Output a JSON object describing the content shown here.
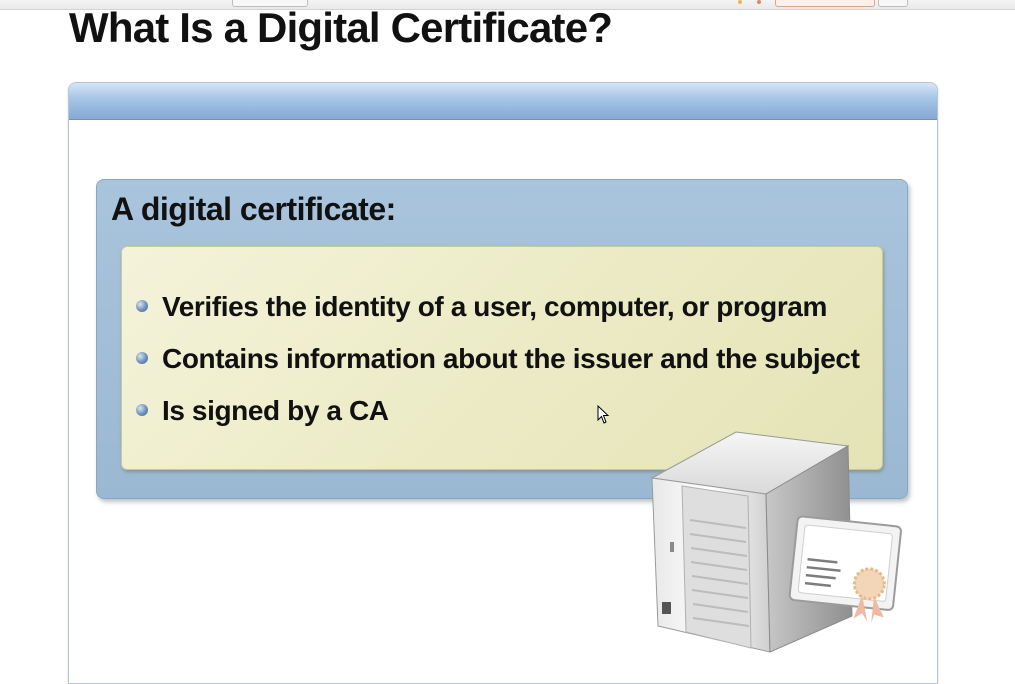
{
  "slide": {
    "title": "What Is a Digital Certificate?",
    "box_heading": "A digital certificate:",
    "bullets": [
      "Verifies the identity of a user, computer, or program",
      "Contains information about the issuer and the subject",
      "Is signed by a CA"
    ]
  },
  "icons": {
    "bullet": "blue-sphere-bullet-icon",
    "illustration": "server-with-certificate-icon",
    "cursor": "mouse-pointer-icon"
  },
  "colors": {
    "header_bar": "#94b5dc",
    "outer_box": "#a9c4dc",
    "inner_box": "#ecebc6",
    "title_text": "#111111"
  }
}
